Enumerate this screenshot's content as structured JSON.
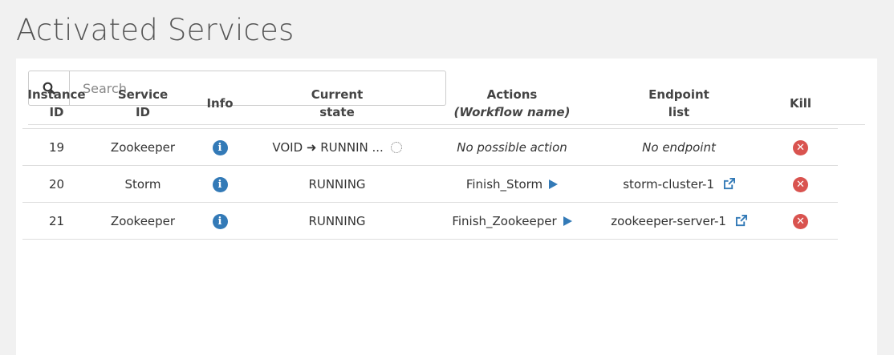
{
  "page": {
    "title": "Activated Services"
  },
  "search": {
    "placeholder": "Search",
    "value": ""
  },
  "table": {
    "headers": {
      "instance_id": [
        "Instance",
        "ID"
      ],
      "service_id": [
        "Service",
        "ID"
      ],
      "info": "Info",
      "current_state": [
        "Current",
        "state"
      ],
      "actions": "Actions",
      "actions_sub": "(Workflow name)",
      "endpoint_list": [
        "Endpoint",
        "list"
      ],
      "kill": "Kill"
    },
    "rows": [
      {
        "instance_id": "19",
        "service_id": "Zookeeper",
        "state": "VOID ➜ RUNNIN ...",
        "action": "No possible action",
        "endpoint": "No endpoint"
      },
      {
        "instance_id": "20",
        "service_id": "Storm",
        "state": "RUNNING",
        "action": "Finish_Storm",
        "endpoint": "storm-cluster-1"
      },
      {
        "instance_id": "21",
        "service_id": "Zookeeper",
        "state": "RUNNING",
        "action": "Finish_Zookeeper",
        "endpoint": "zookeeper-server-1"
      }
    ]
  },
  "icons": {
    "search": "search-icon",
    "info": "info-circle-icon",
    "kill": "times-circle-icon",
    "play": "play-icon",
    "external_link": "external-link-icon",
    "spinner": "spinner-icon"
  },
  "colors": {
    "accent": "#337ab7",
    "danger": "#d9534f",
    "background": "#f1f1f1"
  }
}
